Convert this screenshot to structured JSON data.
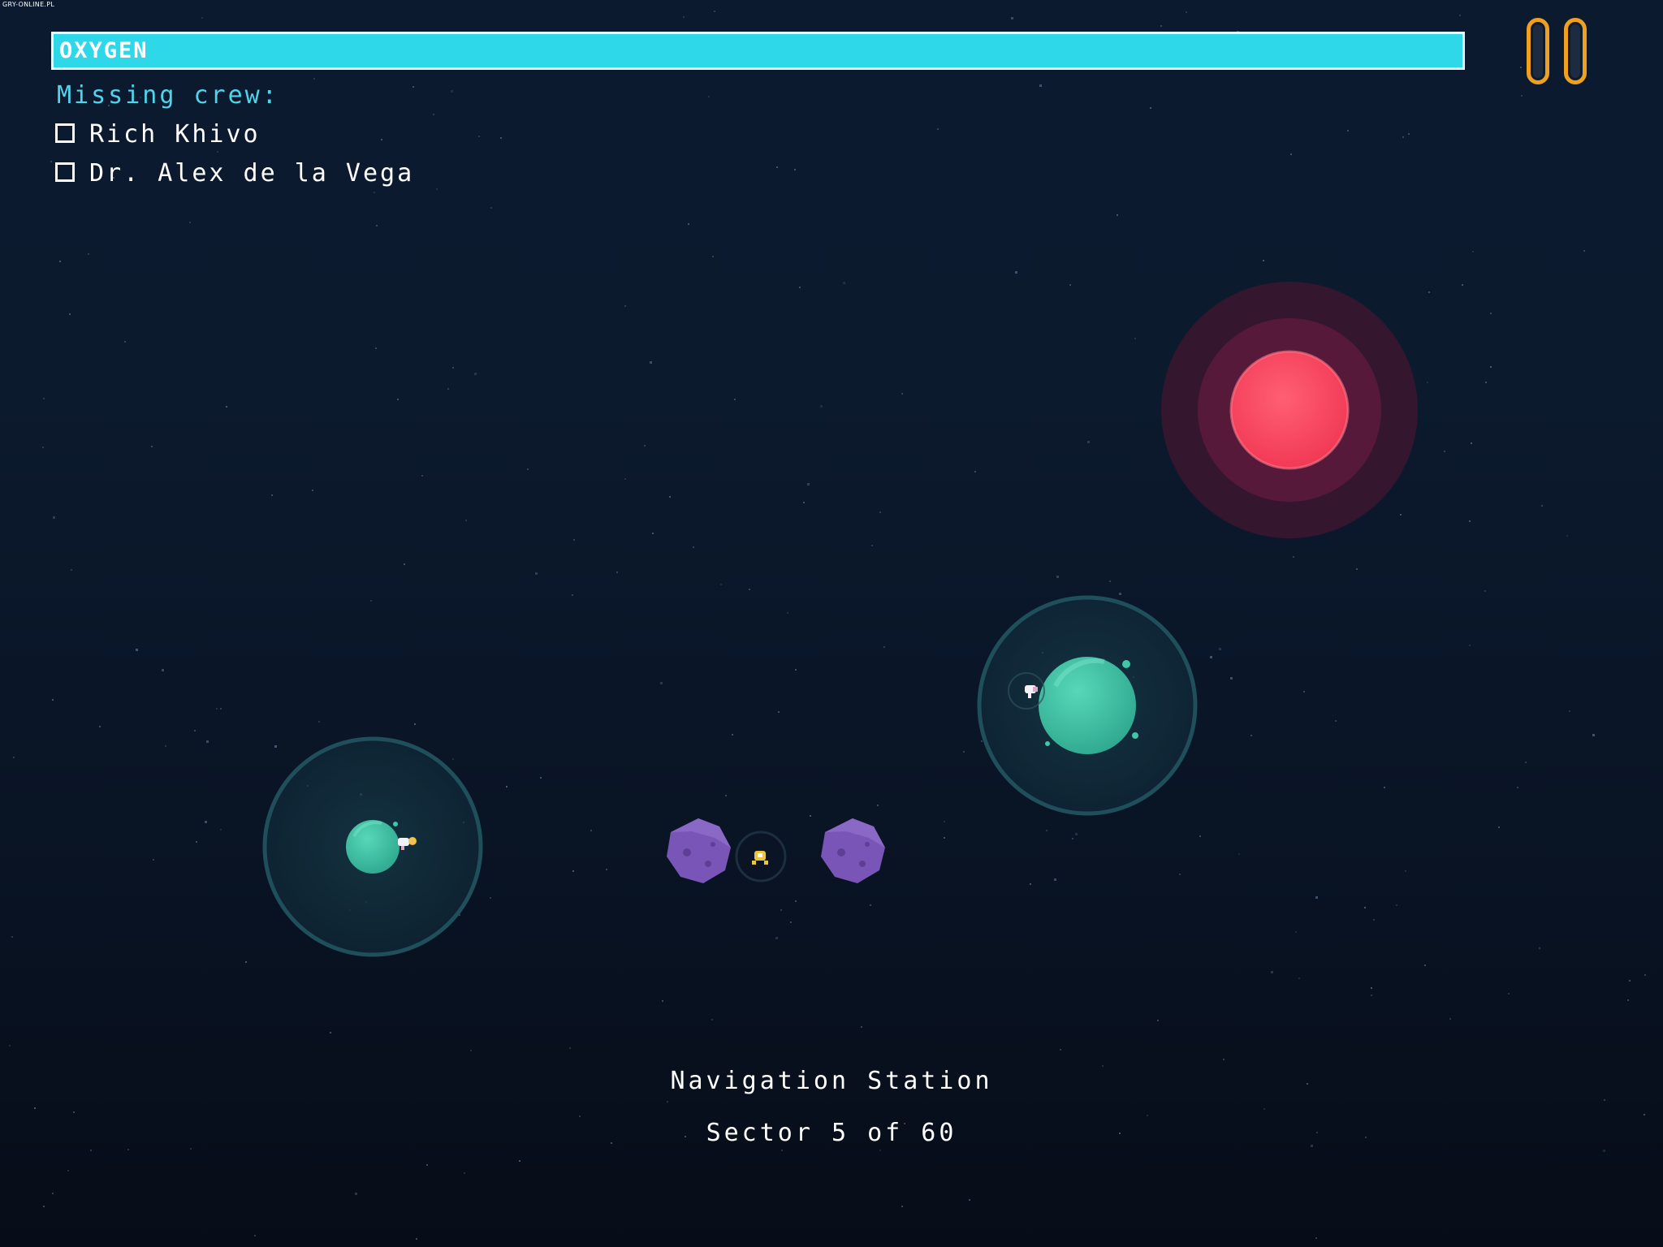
{
  "watermark": "GRY-ONLINE.PL",
  "hud": {
    "oxygen_label": "OXYGEN",
    "oxygen_level": 1.0,
    "oxygen_color": "#2fd8e8",
    "pause_icon": "pause-icon",
    "pause_color": "#f0a020"
  },
  "crew": {
    "heading": "Missing crew:",
    "members": [
      {
        "name": "Rich Khivo",
        "rescued": false
      },
      {
        "name": "Dr. Alex de la Vega",
        "rescued": false
      }
    ]
  },
  "location": {
    "station": "Navigation Station",
    "sector": "Sector 5 of 60"
  },
  "colors": {
    "sun": "#ff3f5a",
    "planet": "#3fc7a8",
    "asteroid": "#7a55b8",
    "background": "#0b1424"
  }
}
